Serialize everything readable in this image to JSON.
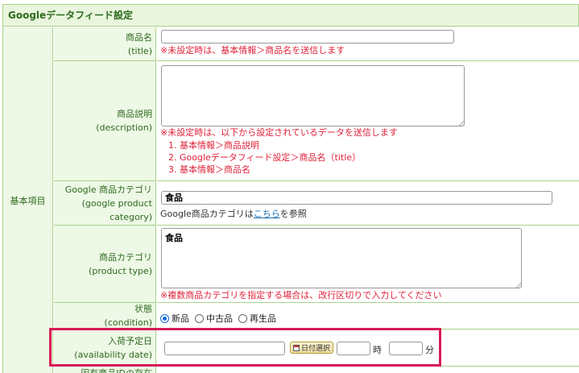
{
  "panel": {
    "title": "Googleデータフィード設定"
  },
  "group": {
    "label": "基本項目"
  },
  "rows": {
    "title": {
      "label_ja": "商品名",
      "label_en": "(title)",
      "value": "",
      "note": "※未設定時は、基本情報＞商品名を送信します"
    },
    "description": {
      "label_ja": "商品説明",
      "label_en": "(description)",
      "value": "",
      "note": "※未設定時は、以下から設定されているデータを送信します",
      "list": [
        "1. 基本情報＞商品説明",
        "2. Googleデータフィード設定＞商品名（title）",
        "3. 基本情報＞商品名"
      ]
    },
    "google_category": {
      "label_ja": "Google 商品カテゴリ",
      "label_en1": "(google product",
      "label_en2": "category)",
      "value": "食品",
      "help_prefix": "Google商品カテゴリは",
      "help_link": "こちら",
      "help_suffix": "を参照"
    },
    "product_type": {
      "label_ja": "商品カテゴリ",
      "label_en": "(product type)",
      "value": "食品",
      "note": "※複数商品カテゴリを指定する場合は、改行区切りで入力してください"
    },
    "condition": {
      "label_ja": "状態",
      "label_en": "(condition)",
      "options": [
        "新品",
        "中古品",
        "再生品"
      ],
      "selected": "新品"
    },
    "availability_date": {
      "label_ja": "入荷予定日",
      "label_en": "(availability date)",
      "date_value": "",
      "date_button": "日付選択",
      "hour_value": "",
      "hour_unit": "時",
      "minute_value": "",
      "minute_unit": "分"
    },
    "identifier": {
      "label_ja": "固有商品IDの存在"
    }
  },
  "colors": {
    "border": "#a8d28a",
    "label_bg": "#eef8e6",
    "label_text": "#2d6a1e",
    "note": "#e0223a",
    "highlight": "#d81b58"
  }
}
